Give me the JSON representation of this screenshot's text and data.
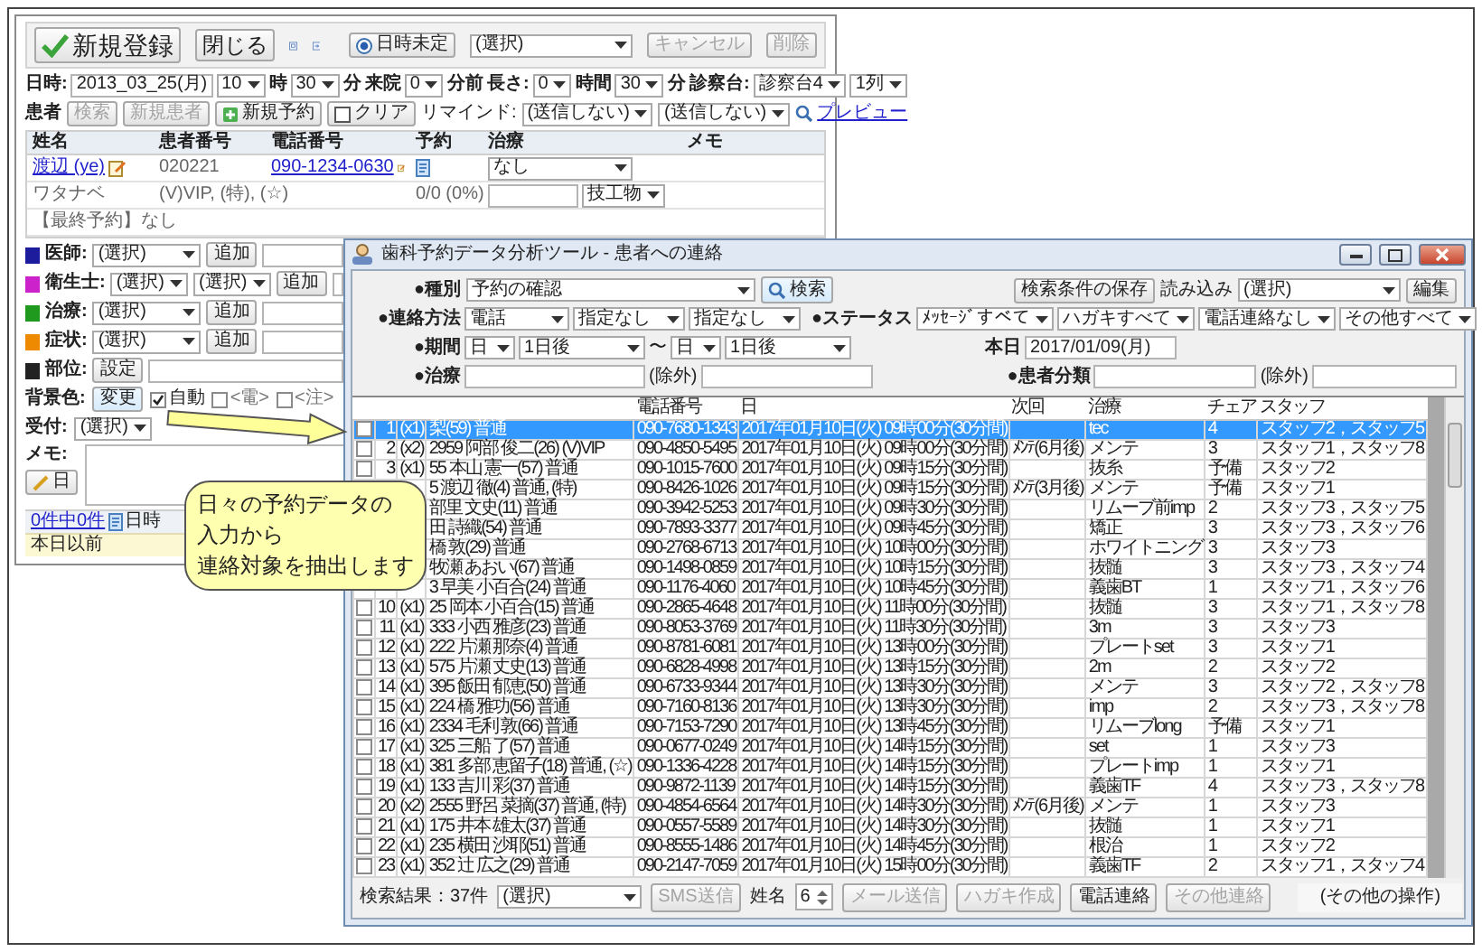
{
  "editor": {
    "new_button": "新規登録",
    "close_button": "閉じる",
    "undecided_radio": {
      "label": "日時未定",
      "selected": true
    },
    "top_select": "(選択)",
    "cancel_button": {
      "label": "キャンセル",
      "disabled": true
    },
    "delete_button": {
      "label": "削除",
      "disabled": true
    },
    "datetime_row": [
      {
        "kind": "label",
        "text": "日時:"
      },
      {
        "kind": "field",
        "text": "2013_03_25(月)"
      },
      {
        "kind": "select",
        "text": "10"
      },
      {
        "kind": "label",
        "text": "時"
      },
      {
        "kind": "select",
        "text": "30"
      },
      {
        "kind": "label",
        "text": "分"
      },
      {
        "kind": "label",
        "text": "来院"
      },
      {
        "kind": "select",
        "text": "0"
      },
      {
        "kind": "label",
        "text": "分前"
      },
      {
        "kind": "label",
        "text": "長さ:"
      },
      {
        "kind": "select",
        "text": "0"
      },
      {
        "kind": "label",
        "text": "時間"
      },
      {
        "kind": "select",
        "text": "30"
      },
      {
        "kind": "label",
        "text": "分"
      },
      {
        "kind": "label",
        "text": "診察台:"
      },
      {
        "kind": "select",
        "text": "診察台4"
      },
      {
        "kind": "select",
        "text": "1列"
      }
    ],
    "patient_row": [
      {
        "kind": "label",
        "text": "患者"
      },
      {
        "kind": "button",
        "text": "検索",
        "disabled": true
      },
      {
        "kind": "button",
        "text": "新規患者",
        "disabled": true
      },
      {
        "kind": "add_button",
        "text": "新規予約",
        "disabled": false
      },
      {
        "kind": "clear_button",
        "text": "クリア",
        "disabled": false
      },
      {
        "kind": "text",
        "text": "リマインド:"
      },
      {
        "kind": "select",
        "text": "(送信しない)"
      },
      {
        "kind": "select",
        "text": "(送信しない)"
      },
      {
        "kind": "preview_link",
        "text": "プレビュー"
      }
    ],
    "patient_columns": [
      "姓名",
      "患者番号",
      "電話番号",
      "予約",
      "治療",
      "メモ"
    ],
    "patient": {
      "name": "渡辺 (ye)",
      "number": "020221",
      "phone": "090-1234-0630",
      "treatment": "なし",
      "kana": "ワタナベ",
      "flags": "(V)VIP, (特), (☆)",
      "ratio": "0/0 (0%)",
      "lab_select": "技工物",
      "last_visit": "【最終予約】なし"
    },
    "assign_rows": [
      {
        "label": "医師:",
        "color": "#1c1c9c",
        "selects": [
          "(選択)"
        ],
        "button": "追加"
      },
      {
        "label": "衛生士:",
        "color": "#cc22cc",
        "selects": [
          "(選択)",
          "(選択)"
        ],
        "button": "追加"
      },
      {
        "label": "治療:",
        "color": "#1f9a1f",
        "selects": [
          "(選択)"
        ],
        "button": "追加"
      },
      {
        "label": "症状:",
        "color": "#ee8a00",
        "selects": [
          "(選択)"
        ],
        "button": "追加"
      },
      {
        "label": "部位:",
        "color": "#222222",
        "selects": [],
        "button": "設定"
      }
    ],
    "background": {
      "label": "背景色:",
      "button": "変更",
      "auto": {
        "label": "自動",
        "checked": true
      },
      "flags": [
        {
          "label": "<電>",
          "checked": false
        },
        {
          "label": "<注>",
          "checked": false
        }
      ],
      "reception_label": "受付:",
      "reception_select": "(選択)"
    },
    "memo": {
      "label": "メモ:",
      "button": "日"
    },
    "list": {
      "count_link": "0件中0件",
      "column": "日時",
      "row": "本日以前"
    }
  },
  "tool": {
    "title": "歯科予約データ分析ツール - 患者への連絡",
    "kind_label": "●種別",
    "kind_select": "予約の確認",
    "search_button": "検索",
    "save_button": "検索条件の保存",
    "load_label": "読み込み",
    "load_select": "(選択)",
    "edit_button": "編集",
    "method_label": "●連絡方法",
    "method_selects": [
      "電話",
      "指定なし",
      "指定なし"
    ],
    "status_label": "●ステータス",
    "status_selects": [
      "ﾒｯｾｰｼﾞすべて",
      "ハガキすべて",
      "電話連絡なし",
      "その他すべて"
    ],
    "period_label": "●期間",
    "period_from": [
      "日",
      "1日後"
    ],
    "tilde": "〜",
    "period_to": [
      "日",
      "1日後"
    ],
    "today_label": "本日",
    "today_value": "2017/01/09(月)",
    "treatment_label": "●治療",
    "treatment_exclude": "(除外)",
    "class_label": "●患者分類",
    "class_exclude": "(除外)",
    "columns": [
      "電話番号",
      "日",
      "次回",
      "治療",
      "チェア",
      "スタッフ"
    ],
    "rows": [
      {
        "checked": false,
        "selected": true,
        "num": "1",
        "count": "(x1)",
        "name": "梨(59) 普通",
        "phone": "090-7680-1343",
        "date": "2017年01月10日(火) 09時00分(30分間)",
        "treatment": "tec",
        "chair": "4",
        "staff": "スタッフ2，スタッフ5"
      },
      {
        "checked": false,
        "selected": false,
        "num": "2",
        "count": "(x2)",
        "name": "2959 阿部 俊二(26) (V)VIP",
        "phone": "090-4850-5495",
        "date": "2017年01月10日(火) 09時00分(30分間)",
        "next": "ﾒﾝﾃ(6月後)",
        "treatment": "メンテ",
        "chair": "3",
        "staff": "スタッフ1，スタッフ8"
      },
      {
        "checked": false,
        "selected": false,
        "num": "3",
        "count": "(x1)",
        "name": "55 本山 憲一(57) 普通",
        "phone": "090-1015-7600",
        "date": "2017年01月10日(火) 09時15分(30分間)",
        "treatment": "抜糸",
        "chair": "予備",
        "staff": "スタッフ2"
      },
      {
        "selected": false,
        "name": "5 渡辺 徹(4) 普通, (特)",
        "phone": "090-8426-1026",
        "date": "2017年01月10日(火) 09時15分(30分間)",
        "next": "ﾒﾝﾃ(3月後)",
        "treatment": "メンテ",
        "chair": "予備",
        "staff": "スタッフ1"
      },
      {
        "selected": false,
        "name": "部里 文史(11) 普通",
        "phone": "090-3942-5253",
        "date": "2017年01月10日(火) 09時30分(30分間)",
        "treatment": "リムーブ前imp",
        "chair": "2",
        "staff": "スタッフ3，スタッフ5"
      },
      {
        "selected": false,
        "name": "田 詩織(54) 普通",
        "phone": "090-7893-3377",
        "date": "2017年01月10日(火) 09時45分(30分間)",
        "treatment": "矯正",
        "chair": "3",
        "staff": "スタッフ3，スタッフ6"
      },
      {
        "selected": false,
        "name": "橋 敦(29) 普通",
        "phone": "090-2768-6713",
        "date": "2017年01月10日(火) 10時00分(30分間)",
        "treatment": "ホワイトニング",
        "chair": "3",
        "staff": "スタッフ3"
      },
      {
        "selected": false,
        "name": "牧瀬 あおい(67) 普通",
        "phone": "090-1498-0859",
        "date": "2017年01月10日(火) 10時15分(30分間)",
        "treatment": "抜髄",
        "chair": "3",
        "staff": "スタッフ3，スタッフ4"
      },
      {
        "selected": false,
        "name": "3 早美 小百合(24) 普通",
        "phone": "090-1176-4060",
        "date": "2017年01月10日(火) 10時45分(30分間)",
        "treatment": "義歯BT",
        "chair": "1",
        "staff": "スタッフ1，スタッフ6"
      },
      {
        "checked": false,
        "selected": false,
        "num": "10",
        "count": "(x1)",
        "name": "25 岡本 小百合(15) 普通",
        "phone": "090-2865-4648",
        "date": "2017年01月10日(火) 11時00分(30分間)",
        "treatment": "抜髄",
        "chair": "3",
        "staff": "スタッフ1，スタッフ8"
      },
      {
        "checked": false,
        "selected": false,
        "num": "11",
        "count": "(x1)",
        "name": "333 小西 雅彦(23) 普通",
        "phone": "090-8053-3769",
        "date": "2017年01月10日(火) 11時30分(30分間)",
        "treatment": "3m",
        "chair": "3",
        "staff": "スタッフ3"
      },
      {
        "checked": false,
        "selected": false,
        "num": "12",
        "count": "(x1)",
        "name": "222 片瀬 那奈(4) 普通",
        "phone": "090-8781-6081",
        "date": "2017年01月10日(火) 13時00分(30分間)",
        "treatment": "プレートset",
        "chair": "3",
        "staff": "スタッフ1"
      },
      {
        "checked": false,
        "selected": false,
        "num": "13",
        "count": "(x1)",
        "name": "575 片瀬 丈史(13) 普通",
        "phone": "090-6828-4998",
        "date": "2017年01月10日(火) 13時15分(30分間)",
        "treatment": "2m",
        "chair": "2",
        "staff": "スタッフ2"
      },
      {
        "checked": false,
        "selected": false,
        "num": "14",
        "count": "(x1)",
        "name": "395 飯田 郁恵(50) 普通",
        "phone": "090-6733-9344",
        "date": "2017年01月10日(火) 13時30分(30分間)",
        "treatment": "メンテ",
        "chair": "3",
        "staff": "スタッフ2，スタッフ8"
      },
      {
        "checked": false,
        "selected": false,
        "num": "15",
        "count": "(x1)",
        "name": "224 橋 雅功(56) 普通",
        "phone": "090-7160-8136",
        "date": "2017年01月10日(火) 13時30分(30分間)",
        "treatment": "imp",
        "chair": "2",
        "staff": "スタッフ3，スタッフ8"
      },
      {
        "checked": false,
        "selected": false,
        "num": "16",
        "count": "(x1)",
        "name": "2334 毛利 敦(66) 普通",
        "phone": "090-7153-7290",
        "date": "2017年01月10日(火) 13時45分(30分間)",
        "treatment": "リムーブlong",
        "chair": "予備",
        "staff": "スタッフ1"
      },
      {
        "checked": false,
        "selected": false,
        "num": "17",
        "count": "(x1)",
        "name": "325 三船 了(57) 普通",
        "phone": "090-0677-0249",
        "date": "2017年01月10日(火) 14時15分(30分間)",
        "treatment": "set",
        "chair": "1",
        "staff": "スタッフ3"
      },
      {
        "checked": false,
        "selected": false,
        "num": "18",
        "count": "(x1)",
        "name": "381 多部 恵留子(18) 普通, (☆)",
        "phone": "090-1336-4228",
        "date": "2017年01月10日(火) 14時15分(30分間)",
        "treatment": "プレートimp",
        "chair": "1",
        "staff": "スタッフ1"
      },
      {
        "checked": false,
        "selected": false,
        "num": "19",
        "count": "(x1)",
        "name": "133 吉川 彩(37) 普通",
        "phone": "090-9872-1139",
        "date": "2017年01月10日(火) 14時15分(30分間)",
        "treatment": "義歯TF",
        "chair": "4",
        "staff": "スタッフ3，スタッフ8"
      },
      {
        "checked": false,
        "selected": false,
        "num": "20",
        "count": "(x2)",
        "name": "2555 野呂 菜摘(37) 普通, (特)",
        "phone": "090-4854-6564",
        "date": "2017年01月10日(火) 14時30分(30分間)",
        "next": "ﾒﾝﾃ(6月後)",
        "treatment": "メンテ",
        "chair": "1",
        "staff": "スタッフ3"
      },
      {
        "checked": false,
        "selected": false,
        "num": "21",
        "count": "(x1)",
        "name": "175 井本 雄太(37) 普通",
        "phone": "090-0557-5589",
        "date": "2017年01月10日(火) 14時30分(30分間)",
        "treatment": "抜髄",
        "chair": "1",
        "staff": "スタッフ1"
      },
      {
        "checked": false,
        "selected": false,
        "num": "22",
        "count": "(x1)",
        "name": "235 横田 沙耶(51) 普通",
        "phone": "090-8555-1486",
        "date": "2017年01月10日(火) 14時45分(30分間)",
        "treatment": "根治",
        "chair": "1",
        "staff": "スタッフ2"
      },
      {
        "checked": false,
        "selected": false,
        "num": "23",
        "count": "(x1)",
        "name": "352 辻 広之(29) 普通",
        "phone": "090-2147-7059",
        "date": "2017年01月10日(火) 15時00分(30分間)",
        "treatment": "義歯TF",
        "chair": "2",
        "staff": "スタッフ1，スタッフ4"
      }
    ],
    "footer": {
      "result": "検索結果：37件",
      "select": "(選択)",
      "sms_button": {
        "label": "SMS送信",
        "disabled": true
      },
      "name_label": "姓名",
      "name_value": "6",
      "buttons": [
        {
          "label": "メール送信",
          "disabled": true
        },
        {
          "label": "ハガキ作成",
          "disabled": true
        },
        {
          "label": "電話連絡",
          "disabled": false
        },
        {
          "label": "その他連絡",
          "disabled": true
        }
      ],
      "other": "(その他の操作)"
    }
  },
  "callout": {
    "lines": [
      "日々の予約データの",
      "入力から",
      "連絡対象を抽出します"
    ]
  }
}
